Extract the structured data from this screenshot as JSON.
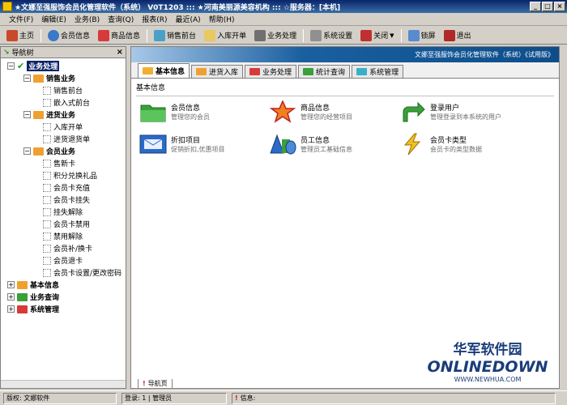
{
  "window": {
    "title": "★文娜至强服饰会员化管理软件（系统）  V0T1203  :::  ★河南美丽源美容机构  :::  ☆服务器：[本机]"
  },
  "menu": [
    "文件(F)",
    "编辑(E)",
    "业务(B)",
    "查询(Q)",
    "报表(R)",
    "最近(A)",
    "帮助(H)"
  ],
  "toolbar": {
    "home": "主页",
    "member_info": "会员信息",
    "product_info": "商品信息",
    "sales_counter": "销售前台",
    "stock_in": "入库开单",
    "business": "业务处理",
    "settings": "系统设置",
    "close": "关闭",
    "lock": "锁屏",
    "exit": "退出"
  },
  "nav": {
    "header": "导航树",
    "root": "业务处理",
    "sales": {
      "label": "销售业务",
      "items": [
        "销售前台",
        "嵌入式前台"
      ]
    },
    "purchase": {
      "label": "进货业务",
      "items": [
        "入库开单",
        "进货退货单"
      ]
    },
    "member": {
      "label": "会员业务",
      "items": [
        "售新卡",
        "积分兑换礼品",
        "会员卡充值",
        "会员卡挂失",
        "挂失解除",
        "会员卡禁用",
        "禁用解除",
        "会员补/换卡",
        "会员退卡",
        "会员卡设置/更改密码"
      ]
    },
    "basic_info": "基本信息",
    "business_query": "业务查询",
    "system_management": "系统管理"
  },
  "banner": "文娜至强服饰会员化管理软件（系统）《试用版》",
  "tabs": [
    "基本信息",
    "进货入库",
    "业务处理",
    "统计查询",
    "系统管理"
  ],
  "section_title": "基本信息",
  "items": [
    {
      "title": "会员信息",
      "desc": "管理您的会员"
    },
    {
      "title": "商品信息",
      "desc": "管理您的经营项目"
    },
    {
      "title": "登录用户",
      "desc": "管理登录到本系统的用户"
    },
    {
      "title": "折扣项目",
      "desc": "促销折扣,优惠项目"
    },
    {
      "title": "员工信息",
      "desc": "管理员工基础信息"
    },
    {
      "title": "会员卡类型",
      "desc": "会员卡的类型数据"
    }
  ],
  "bottom_tab": "导航页",
  "watermark": {
    "cn": "华军软件园",
    "logo": "ONLINEDOWN",
    "url": "WWW.NEWHUA.COM"
  },
  "status": {
    "copyright": "版权: 文娜软件",
    "login": "登录: 1 | 管理员",
    "info": "信息:"
  }
}
